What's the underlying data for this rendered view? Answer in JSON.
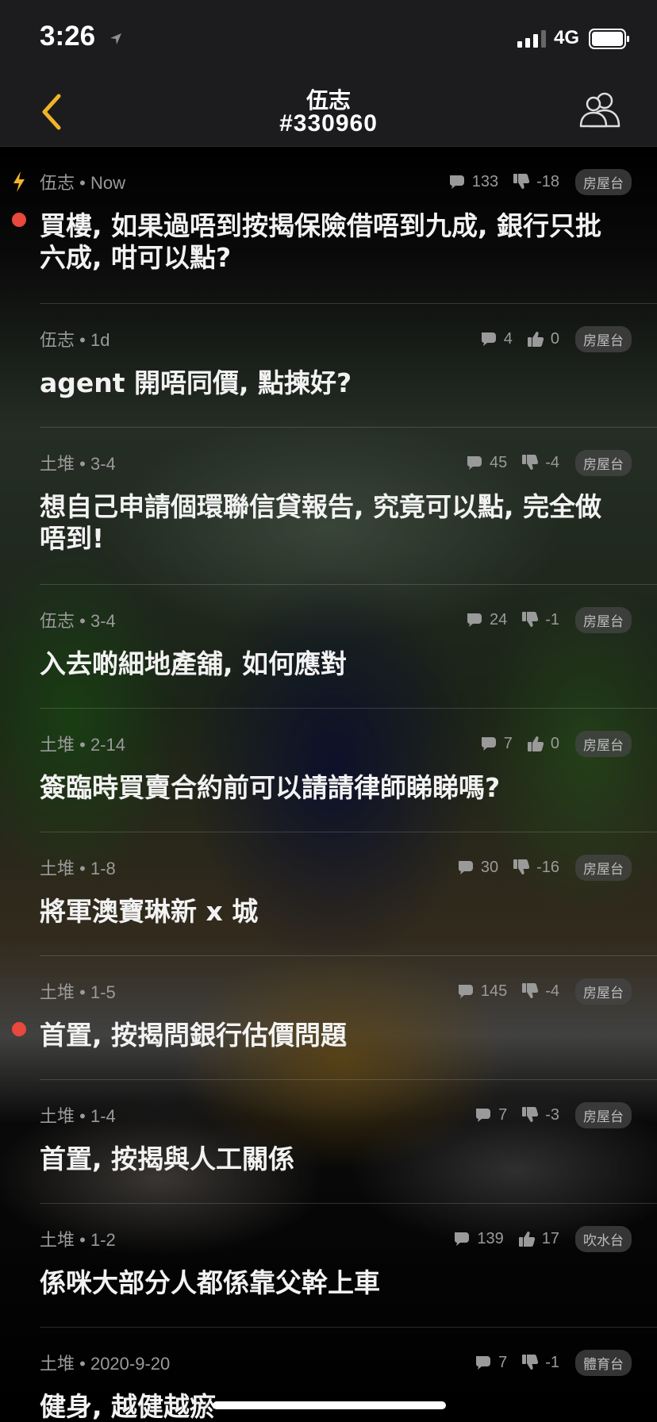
{
  "status_bar": {
    "time": "3:26",
    "network": "4G"
  },
  "nav": {
    "title": "伍志",
    "subtitle": "#330960"
  },
  "threads": [
    {
      "author": "伍志",
      "time": "Now",
      "replies": "133",
      "vote_icon": "thumbs-down-icon",
      "votes": "-18",
      "category": "房屋台",
      "title": "買樓, 如果過唔到按揭保險借唔到九成, 銀行只批六成, 咁可以點?",
      "unread": true,
      "latest": true
    },
    {
      "author": "伍志",
      "time": "1d",
      "replies": "4",
      "vote_icon": "thumbs-up-icon",
      "votes": "0",
      "category": "房屋台",
      "title": "agent 開唔同價, 點揀好?",
      "unread": false
    },
    {
      "author": "土堆",
      "time": "3-4",
      "replies": "45",
      "vote_icon": "thumbs-down-icon",
      "votes": "-4",
      "category": "房屋台",
      "title": "想自己申請個環聯信貸報告, 究竟可以點, 完全做唔到!",
      "unread": false
    },
    {
      "author": "伍志",
      "time": "3-4",
      "replies": "24",
      "vote_icon": "thumbs-down-icon",
      "votes": "-1",
      "category": "房屋台",
      "title": "入去啲細地產舖, 如何應對",
      "unread": false
    },
    {
      "author": "土堆",
      "time": "2-14",
      "replies": "7",
      "vote_icon": "thumbs-up-icon",
      "votes": "0",
      "category": "房屋台",
      "title": "簽臨時買賣合約前可以請請律師睇睇嗎?",
      "unread": false
    },
    {
      "author": "土堆",
      "time": "1-8",
      "replies": "30",
      "vote_icon": "thumbs-down-icon",
      "votes": "-16",
      "category": "房屋台",
      "title": "將軍澳寶琳新 x 城",
      "unread": false
    },
    {
      "author": "土堆",
      "time": "1-5",
      "replies": "145",
      "vote_icon": "thumbs-down-icon",
      "votes": "-4",
      "category": "房屋台",
      "title": "首置, 按揭問銀行估價問題",
      "unread": true
    },
    {
      "author": "土堆",
      "time": "1-4",
      "replies": "7",
      "vote_icon": "thumbs-down-icon",
      "votes": "-3",
      "category": "房屋台",
      "title": "首置, 按揭與人工關係",
      "unread": false
    },
    {
      "author": "土堆",
      "time": "1-2",
      "replies": "139",
      "vote_icon": "thumbs-up-icon",
      "votes": "17",
      "category": "吹水台",
      "title": "係咪大部分人都係靠父幹上車",
      "unread": false
    },
    {
      "author": "土堆",
      "time": "2020-9-20",
      "replies": "7",
      "vote_icon": "thumbs-down-icon",
      "votes": "-1",
      "category": "體育台",
      "title": "健身, 越健越瘀",
      "unread": false
    }
  ],
  "colors": {
    "accent": "#f0b429",
    "unread_dot": "#e8483d",
    "bar_bg": "#1c1c1e"
  }
}
